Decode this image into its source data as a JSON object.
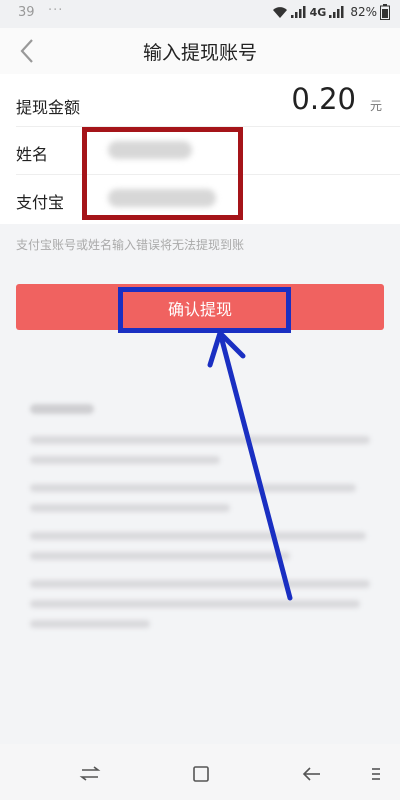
{
  "status_bar": {
    "time": "39",
    "dots": "···",
    "network": "4G",
    "battery": "82%"
  },
  "header": {
    "title": "输入提现账号",
    "back_icon": "chevron-left-icon"
  },
  "form": {
    "amount_label": "提现金额",
    "amount_value": "0.20",
    "amount_unit": "元",
    "name_label": "姓名",
    "alipay_label": "支付宝"
  },
  "hint": "支付宝账号或姓名输入错误将无法提现到账",
  "confirm_button": {
    "label": "确认提现"
  },
  "nav_bar": {
    "icons": [
      "switch-arrows-icon",
      "square-home-icon",
      "back-arrow-icon",
      "menu-icon"
    ]
  },
  "colors": {
    "button": "#f06260",
    "annotation_red": "#a51419",
    "annotation_blue": "#1a2fc2"
  }
}
